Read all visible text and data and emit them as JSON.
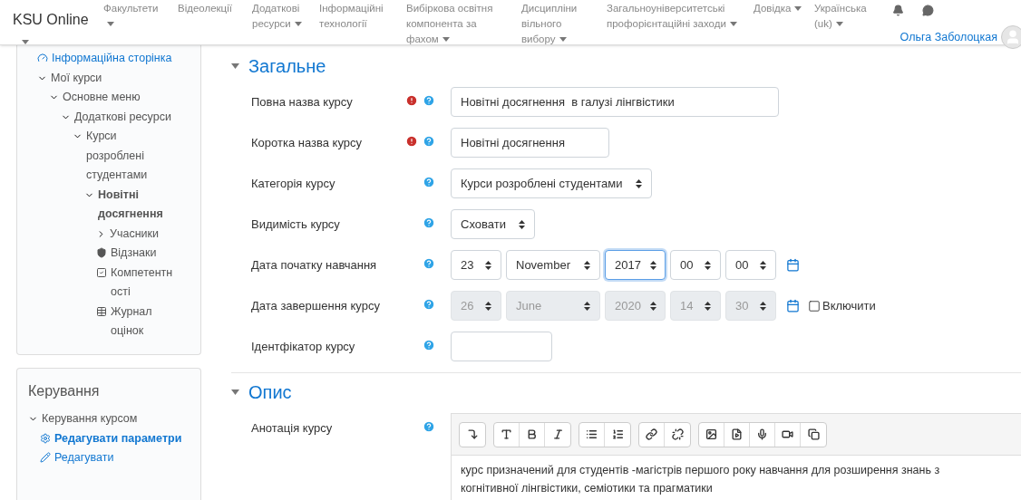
{
  "navbar": {
    "brand": "KSU Online",
    "brand_menu": true,
    "items": [
      {
        "label": "Факультети",
        "has_menu": true
      },
      {
        "label": "Відеолекції",
        "has_menu": false
      },
      {
        "label": "Додаткові ресурси",
        "has_menu": true
      },
      {
        "label": "Інформаційні технології",
        "has_menu": false
      },
      {
        "label": "Вибіркова освітня компонента за фахом",
        "has_menu": true
      },
      {
        "label": "Дисципліни вільного вибору",
        "has_menu": true
      },
      {
        "label": "Загальноуніверситетські профорієнтаційні заходи",
        "has_menu": true
      },
      {
        "label": "Довідка",
        "has_menu": true
      },
      {
        "label": "Українська (uk)",
        "has_menu": true
      }
    ],
    "user": "Ольга Заболоцкая"
  },
  "navigation": {
    "tree": [
      {
        "label": "Інформаційна сторінка",
        "link": true,
        "active": false
      },
      {
        "label": "Мої курси",
        "expanded": true,
        "link": false,
        "active": false,
        "children": [
          {
            "label": "Основне меню",
            "expanded": true,
            "link": false,
            "active": false,
            "children": [
              {
                "label": "Додаткові ресурси",
                "expanded": true,
                "link": false,
                "active": false,
                "children": [
                  {
                    "label": "Курси розроблені студентами",
                    "expanded": true,
                    "link": false,
                    "active": false,
                    "children": [
                      {
                        "label": "Новітні досягнення",
                        "expanded": true,
                        "link": false,
                        "active": true,
                        "children": [
                          {
                            "label": "Учасники",
                            "expanded": false,
                            "link": false,
                            "active": false
                          },
                          {
                            "label": "Відзнаки",
                            "link": false,
                            "active": false
                          },
                          {
                            "label": "Компетентності",
                            "link": false,
                            "active": false
                          },
                          {
                            "label": "Журнал оцінок",
                            "link": false,
                            "active": false
                          }
                        ]
                      }
                    ]
                  }
                ]
              }
            ]
          }
        ]
      }
    ]
  },
  "administration": {
    "title": "Керування",
    "tree": [
      {
        "label": "Керування курсом",
        "expanded": true,
        "link": false,
        "active": false,
        "children": [
          {
            "label": "Редагувати параметри",
            "link": true,
            "active": true
          },
          {
            "label": "Редагувати",
            "link": true,
            "active": false
          }
        ]
      }
    ]
  },
  "sections": [
    {
      "title": "Загальне",
      "expanded": true,
      "fields": [
        {
          "kind": "text",
          "label": "Повна назва курсу",
          "required": true,
          "value": "Новітні досягнення  в галузі лінгвістики"
        },
        {
          "kind": "text",
          "label": "Коротка назва курсу",
          "required": true,
          "value": "Новітні досягнення"
        },
        {
          "kind": "select",
          "label": "Категорія курсу",
          "required": false,
          "value": "Курси розроблені студентами"
        },
        {
          "kind": "select",
          "label": "Видимість курсу",
          "required": false,
          "value": "Сховати"
        },
        {
          "kind": "date",
          "label": "Дата початку навчання",
          "required": false,
          "disabled": false,
          "parts": [
            {
              "value": "23",
              "focused": false
            },
            {
              "value": "November",
              "focused": false
            },
            {
              "value": "2017",
              "focused": true
            },
            {
              "value": "00",
              "focused": false
            },
            {
              "value": "00",
              "focused": false
            }
          ]
        },
        {
          "kind": "date",
          "label": "Дата завершення курсу",
          "required": false,
          "disabled": true,
          "parts": [
            {
              "value": "26",
              "focused": false
            },
            {
              "value": "June",
              "focused": false
            },
            {
              "value": "2020",
              "focused": false
            },
            {
              "value": "14",
              "focused": false
            },
            {
              "value": "30",
              "focused": false
            }
          ],
          "enable": {
            "label": "Включити",
            "checked": false
          }
        },
        {
          "kind": "text",
          "label": "Ідентфікатор курсу",
          "required": false
        }
      ]
    },
    {
      "title": "Опис",
      "expanded": true,
      "fields": [
        {
          "kind": "editor",
          "label": "Анотація курсу",
          "required": false,
          "value": "курс призначений для студентів -магістрів першого року навчання для розширення знань з когнітивної лінгвістики, семіотики та прагматики"
        }
      ]
    }
  ]
}
